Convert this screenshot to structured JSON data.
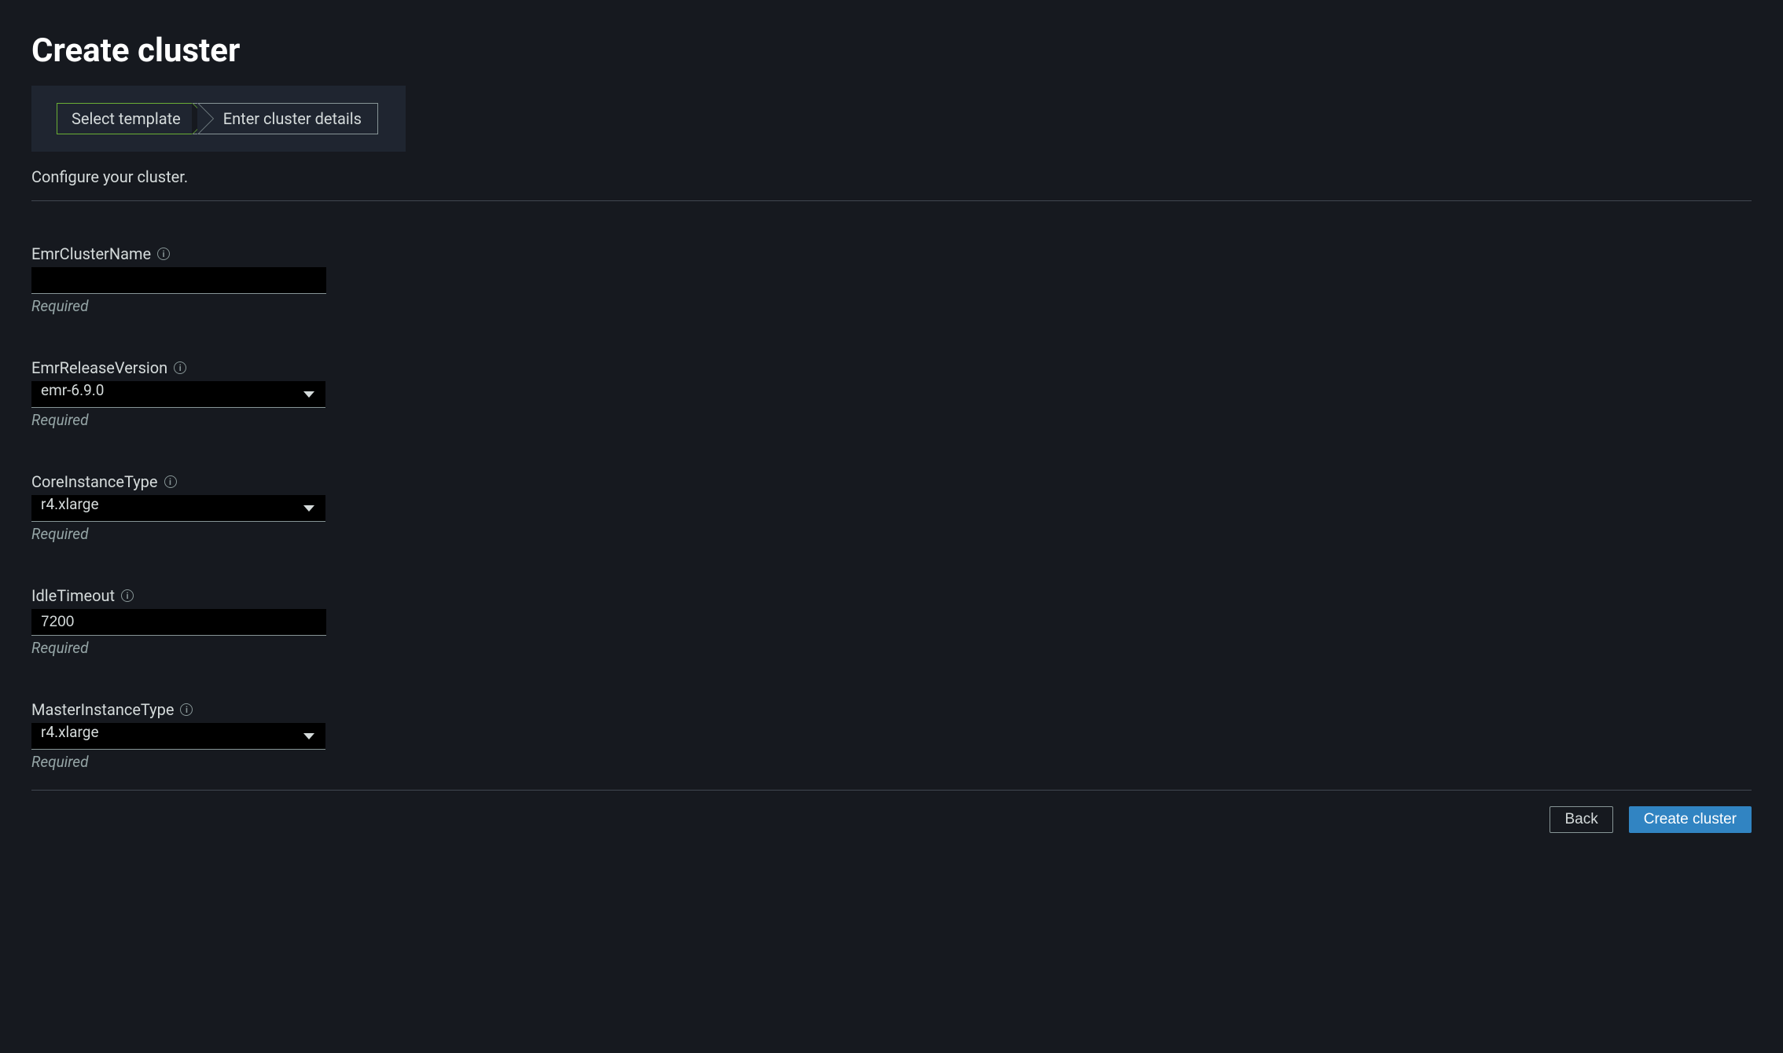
{
  "page_title": "Create cluster",
  "stepper": {
    "step1": "Select template",
    "step2": "Enter cluster details"
  },
  "subtitle": "Configure your cluster.",
  "fields": {
    "cluster_name": {
      "label": "EmrClusterName",
      "value": "",
      "hint": "Required"
    },
    "release_version": {
      "label": "EmrReleaseVersion",
      "value": "emr-6.9.0",
      "hint": "Required"
    },
    "core_instance_type": {
      "label": "CoreInstanceType",
      "value": "r4.xlarge",
      "hint": "Required"
    },
    "idle_timeout": {
      "label": "IdleTimeout",
      "value": "7200",
      "hint": "Required"
    },
    "master_instance_type": {
      "label": "MasterInstanceType",
      "value": "r4.xlarge",
      "hint": "Required"
    }
  },
  "footer": {
    "back": "Back",
    "create": "Create cluster"
  }
}
